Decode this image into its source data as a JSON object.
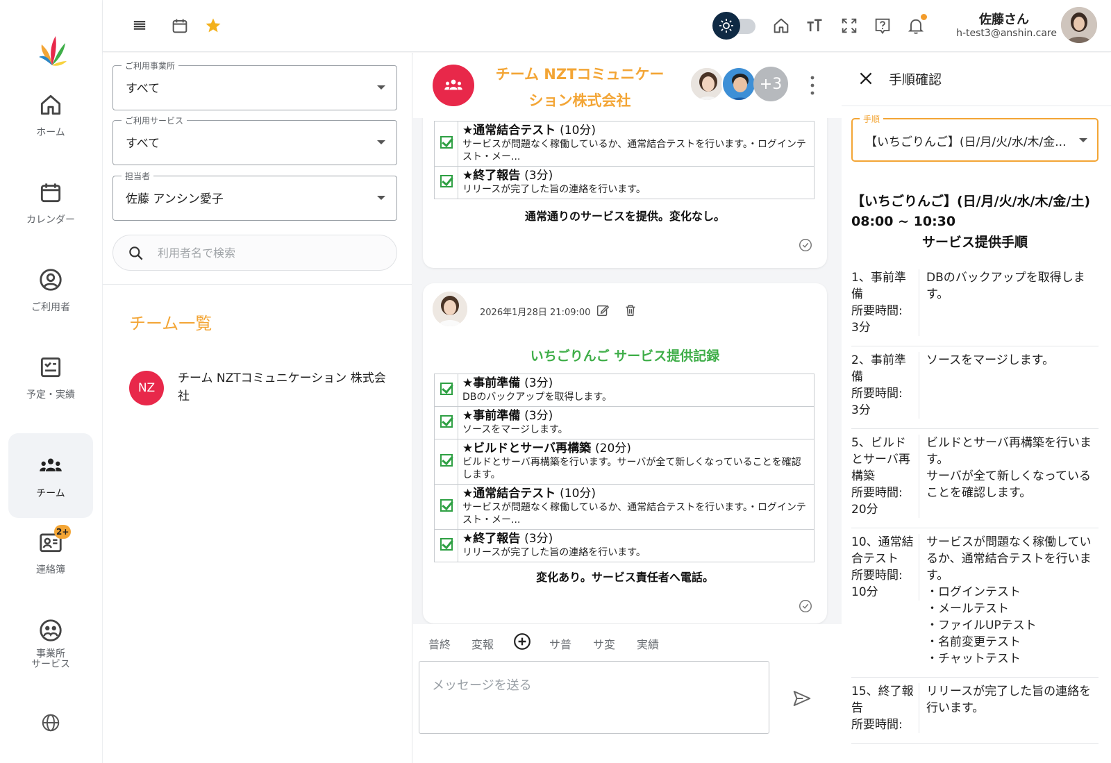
{
  "nav": {
    "items": [
      {
        "label": "ホーム",
        "icon": "home-icon"
      },
      {
        "label": "カレンダー",
        "icon": "calendar-icon"
      },
      {
        "label": "ご利用者",
        "icon": "user-circle-icon"
      },
      {
        "label": "予定・実績",
        "icon": "checklist-icon"
      },
      {
        "label": "チーム",
        "icon": "team-icon"
      },
      {
        "label": "連絡簿",
        "icon": "contact-book-icon",
        "badge": "2+"
      },
      {
        "label": "事業所\nサービス",
        "icon": "office-service-icon"
      }
    ],
    "globe_icon": "globe-icon"
  },
  "topbar": {
    "icons": [
      "menu-icon",
      "calendar-icon",
      "star-icon",
      "theme-toggle",
      "home-icon",
      "text-size-icon",
      "fullscreen-icon",
      "help-icon",
      "bell-icon"
    ],
    "user_name": "佐藤さん",
    "user_email": "h-test3@anshin.care"
  },
  "filters": {
    "office": {
      "label": "ご利用事業所",
      "value": "すべて"
    },
    "service": {
      "label": "ご利用サービス",
      "value": "すべて"
    },
    "staff": {
      "label": "担当者",
      "value": "佐藤 アンシン愛子"
    },
    "search_placeholder": "利用者名で検索",
    "team_list_title": "チーム一覧",
    "team": {
      "initials": "NZ",
      "name": "チーム NZTコミュニケーション 株式会社"
    }
  },
  "chat": {
    "title": "チーム NZTコミュニケーション株式会社",
    "more_members": "+3",
    "card1": {
      "steps": [
        {
          "title": "★通常結合テスト",
          "duration": "(10分)",
          "desc": "サービスが問題なく稼働しているか、通常結合テストを行います。・ログインテスト・メー..."
        },
        {
          "title": "★終了報告",
          "duration": "(3分)",
          "desc": "リリースが完了した旨の連絡を行います。"
        }
      ],
      "summary": "通常通りのサービスを提供。変化なし。"
    },
    "card2": {
      "timestamp": "2026年1月28日 21:09:00",
      "heading": "いちごりんご サービス提供記録",
      "steps": [
        {
          "title": "★事前準備",
          "duration": "(3分)",
          "desc": "DBのバックアップを取得します。"
        },
        {
          "title": "★事前準備",
          "duration": "(3分)",
          "desc": "ソースをマージします。"
        },
        {
          "title": "★ビルドとサーバ再構築",
          "duration": "(20分)",
          "desc": "ビルドとサーバ再構築を行います。サーバが全て新しくなっていることを確認します。"
        },
        {
          "title": "★通常結合テスト",
          "duration": "(10分)",
          "desc": "サービスが問題なく稼働しているか、通常結合テストを行います。・ログインテスト・メー..."
        },
        {
          "title": "★終了報告",
          "duration": "(3分)",
          "desc": "リリースが完了した旨の連絡を行います。"
        }
      ],
      "summary": "変化あり。サービス責任者へ電話。"
    },
    "quick_buttons": [
      "普終",
      "変報",
      "サ普",
      "サ変",
      "実績"
    ],
    "message_placeholder": "メッセージを送る"
  },
  "procedure": {
    "title": "手順確認",
    "select_label": "手順",
    "select_value": "【いちごりんご】(日/月/火/水/木/金...",
    "heading": "【いちごりんご】(日/月/火/水/木/金/土) 08:00 ~ 10:30",
    "subheading": "サービス提供手順",
    "steps": [
      {
        "left": "1、事前準備\n所要時間:\n3分",
        "right": "DBのバックアップを取得します。"
      },
      {
        "left": "2、事前準備\n所要時間:\n3分",
        "right": "ソースをマージします。"
      },
      {
        "left": "5、ビルドとサーバ再構築\n所要時間:\n20分",
        "right": "ビルドとサーバ再構築を行います。\nサーバが全て新しくなっていることを確認します。"
      },
      {
        "left": "10、通常結合テスト\n所要時間:\n10分",
        "right": "サービスが問題なく稼働しているか、通常結合テストを行います。\n・ログインテスト\n・メールテスト\n・ファイルUPテスト\n・名前変更テスト\n・チャットテスト"
      },
      {
        "left": "15、終了報告\n所要時間:",
        "right": "リリースが完了した旨の連絡を行います。"
      }
    ]
  },
  "colors": {
    "accent_orange": "#f3a535",
    "team_red": "#e8284a",
    "check_green": "#2ea043",
    "heading_green": "#3fae49"
  }
}
